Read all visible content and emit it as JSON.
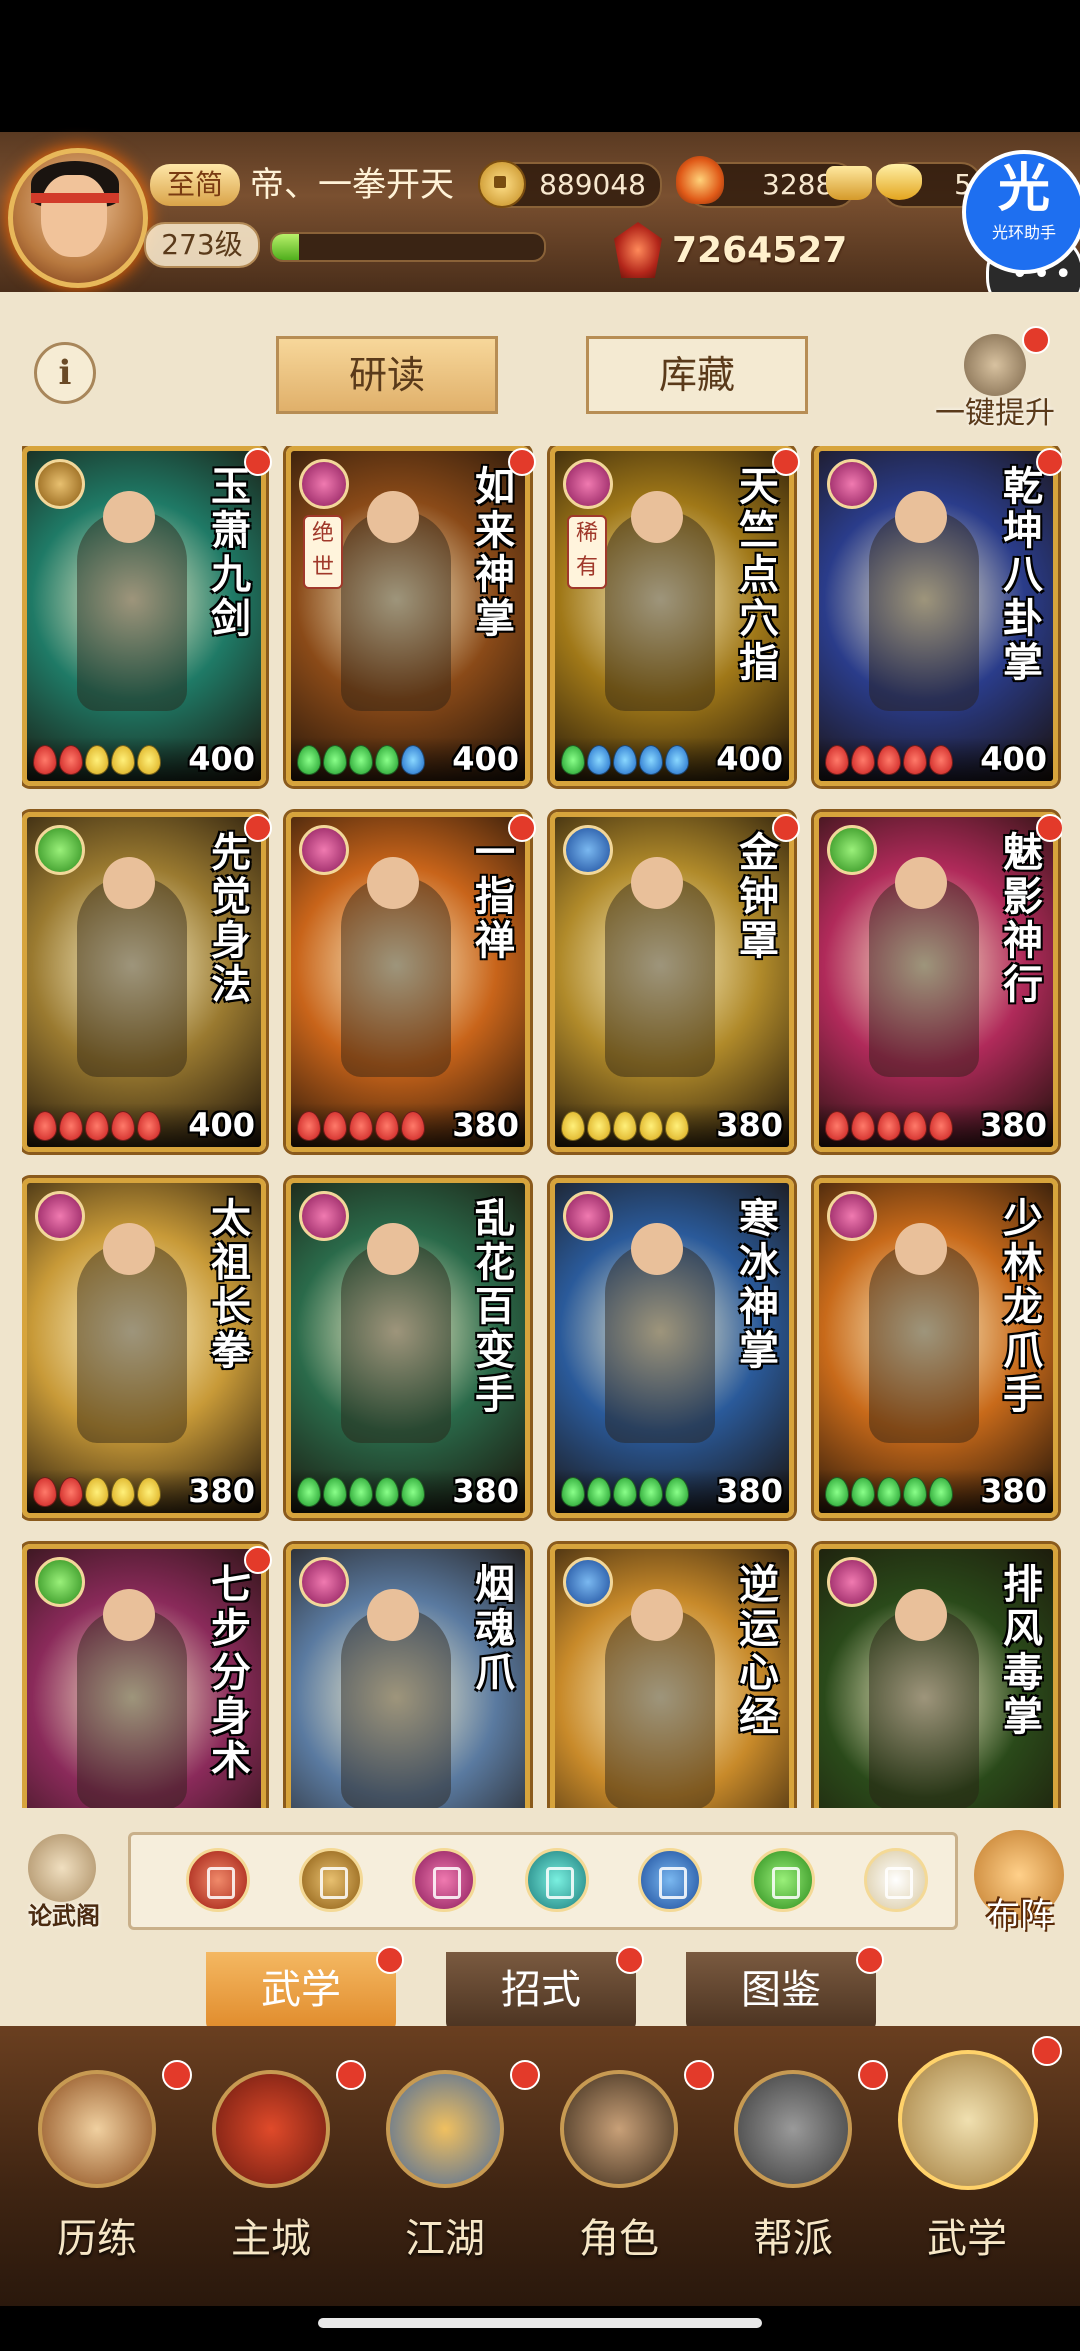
{
  "header": {
    "vip_label": "至简",
    "player_name": "帝、一拳开天",
    "coins": "889048",
    "ingots": "3288",
    "yuanbao": "5",
    "level": "273级",
    "exp_fraction": 0.1,
    "power": "7264527",
    "assist_big": "光",
    "assist_small": "光环助手"
  },
  "tabs": {
    "study": "研读",
    "storage": "库藏",
    "upgrade_all": "一键提升"
  },
  "cards": [
    {
      "title": "玉萧九剑",
      "value": "400",
      "class": "gold",
      "tag": "",
      "bg": "#1f7a66",
      "beads": [
        "r",
        "r",
        "y",
        "y",
        "y"
      ],
      "dot": true
    },
    {
      "title": "如来神掌",
      "value": "400",
      "class": "pink",
      "tag": "绝世",
      "bg": "#8a4a18",
      "beads": [
        "g",
        "g",
        "g",
        "g",
        "b"
      ],
      "dot": true
    },
    {
      "title": "天竺点穴指",
      "value": "400",
      "class": "pink",
      "tag": "稀有",
      "bg": "#a07818",
      "beads": [
        "g",
        "b",
        "b",
        "b",
        "b"
      ],
      "dot": true
    },
    {
      "title": "乾坤八卦掌",
      "value": "400",
      "class": "pink",
      "tag": "",
      "bg": "#2a3c8a",
      "beads": [
        "r",
        "r",
        "r",
        "r",
        "r"
      ],
      "dot": true
    },
    {
      "title": "先觉身法",
      "value": "400",
      "class": "green",
      "tag": "",
      "bg": "#9a7a30",
      "beads": [
        "r",
        "r",
        "r",
        "r",
        "r"
      ],
      "dot": true
    },
    {
      "title": "一指禅",
      "value": "380",
      "class": "pink",
      "tag": "",
      "bg": "#c8641a",
      "beads": [
        "r",
        "r",
        "r",
        "r",
        "r"
      ],
      "dot": true
    },
    {
      "title": "金钟罩",
      "value": "380",
      "class": "blue",
      "tag": "",
      "bg": "#b08a2a",
      "beads": [
        "y",
        "y",
        "y",
        "y",
        "y"
      ],
      "dot": true
    },
    {
      "title": "魅影神行",
      "value": "380",
      "class": "green",
      "tag": "",
      "bg": "#b02a5a",
      "beads": [
        "r",
        "r",
        "r",
        "r",
        "r"
      ],
      "dot": true
    },
    {
      "title": "太祖长拳",
      "value": "380",
      "class": "pink",
      "tag": "",
      "bg": "#c89a38",
      "beads": [
        "r",
        "r",
        "y",
        "y",
        "y"
      ],
      "dot": false
    },
    {
      "title": "乱花百变手",
      "value": "380",
      "class": "pink",
      "tag": "",
      "bg": "#2a6a4a",
      "beads": [
        "g",
        "g",
        "g",
        "g",
        "g"
      ],
      "dot": false
    },
    {
      "title": "寒冰神掌",
      "value": "380",
      "class": "pink",
      "tag": "",
      "bg": "#2a5a9a",
      "beads": [
        "g",
        "g",
        "g",
        "g",
        "g"
      ],
      "dot": false
    },
    {
      "title": "少林龙爪手",
      "value": "380",
      "class": "pink",
      "tag": "",
      "bg": "#c86a1a",
      "beads": [
        "g",
        "g",
        "g",
        "g",
        "g"
      ],
      "dot": false
    },
    {
      "title": "七步分身术",
      "value": "",
      "class": "green",
      "tag": "",
      "bg": "#8a2a5a",
      "beads": [],
      "dot": true
    },
    {
      "title": "烟魂爪",
      "value": "",
      "class": "pink",
      "tag": "",
      "bg": "#5a7aa0",
      "beads": [],
      "dot": false
    },
    {
      "title": "逆运心经",
      "value": "",
      "class": "blue",
      "tag": "",
      "bg": "#c88a2a",
      "beads": [],
      "dot": false
    },
    {
      "title": "排风毒掌",
      "value": "",
      "class": "pink",
      "tag": "",
      "bg": "#2a4a1a",
      "beads": [],
      "dot": false
    }
  ],
  "filters": {
    "left_label": "论武阁",
    "right_label": "布阵",
    "icons": [
      "red",
      "gold",
      "pink",
      "teal",
      "blue",
      "green",
      "up"
    ]
  },
  "sub_tabs": [
    {
      "label": "武学",
      "active": true
    },
    {
      "label": "招式",
      "active": false
    },
    {
      "label": "图鉴",
      "active": false
    }
  ],
  "nav": [
    {
      "label": "历练"
    },
    {
      "label": "主城"
    },
    {
      "label": "江湖"
    },
    {
      "label": "角色"
    },
    {
      "label": "帮派"
    },
    {
      "label": "武学"
    }
  ],
  "colors": {
    "accent_gold": "#d7a43c",
    "badge_red": "#e33a2a",
    "panel_bg": "#efe4cc"
  }
}
